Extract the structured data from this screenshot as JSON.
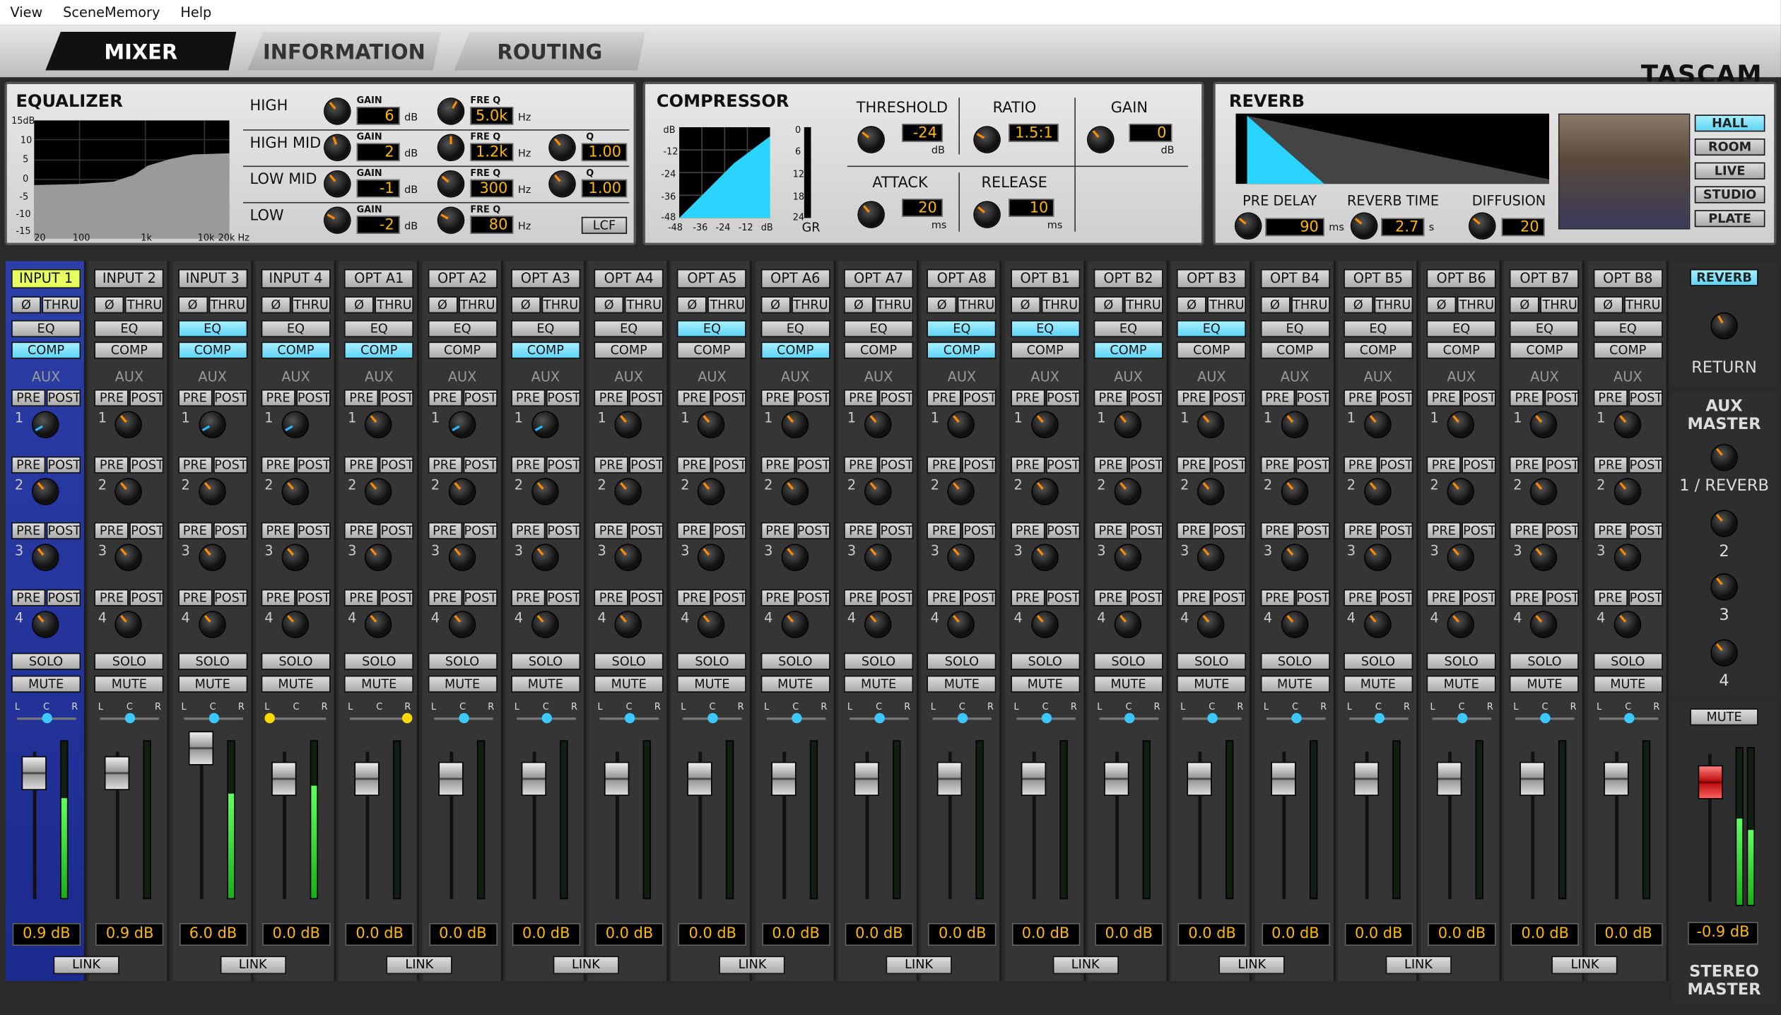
{
  "menu": {
    "view": "View",
    "scene": "SceneMemory",
    "help": "Help"
  },
  "tabs": {
    "mixer": "MIXER",
    "information": "INFORMATION",
    "routing": "ROUTING"
  },
  "brand": "TASCAM",
  "eq": {
    "title": "EQUALIZER",
    "high": "HIGH",
    "high_mid": "HIGH MID",
    "low_mid": "LOW MID",
    "low": "LOW",
    "gain": "GAIN",
    "freq": "FRE Q",
    "q": "Q",
    "db": "dB",
    "hz": "Hz",
    "high_gain": "6",
    "high_freq": "5.0k",
    "hm_gain": "2",
    "hm_freq": "1.2k",
    "hm_q": "1.00",
    "lm_gain": "-1",
    "lm_freq": "300",
    "lm_q": "1.00",
    "low_gain": "-2",
    "low_freq": "80",
    "lcf": "LCF",
    "y15": "15dB",
    "y10": "10",
    "y5": "5",
    "y0": "0",
    "ym5": "-5",
    "ym10": "-10",
    "ym15": "-15",
    "x20": "20",
    "x100": "100",
    "x1k": "1k",
    "x10k": "10k",
    "x20k": "20k Hz"
  },
  "comp": {
    "title": "COMPRESSOR",
    "threshold": "THRESHOLD",
    "threshold_val": "-24",
    "ratio": "RATIO",
    "ratio_val": "1.5:1",
    "gain": "GAIN",
    "gain_val": "0",
    "attack": "ATTACK",
    "attack_val": "20",
    "release": "RELEASE",
    "release_val": "10",
    "db": "dB",
    "ms": "ms",
    "gr": "GR",
    "yd": "dB",
    "y12": "-12",
    "y24": "-24",
    "y36": "-36",
    "y48": "-48",
    "x48": "-48",
    "x36": "-36",
    "x24": "-24",
    "x12": "-12",
    "xd": "dB",
    "g0": "0",
    "g6": "6",
    "g12": "12",
    "g18": "18",
    "g24": "24"
  },
  "reverb": {
    "title": "REVERB",
    "pre_delay": "PRE DELAY",
    "pre_delay_val": "90",
    "reverb_time": "REVERB TIME",
    "reverb_time_val": "2.7",
    "diffusion": "DIFFUSION",
    "diffusion_val": "20",
    "ms": "ms",
    "s": "s",
    "types": [
      "HALL",
      "ROOM",
      "LIVE",
      "STUDIO",
      "PLATE"
    ]
  },
  "strip_labels": {
    "phase": "Ø",
    "thru": "THRU",
    "eq": "EQ",
    "comp": "COMP",
    "aux": "AUX",
    "pre": "PRE",
    "post": "POST",
    "solo": "SOLO",
    "mute": "MUTE",
    "l": "L",
    "c": "C",
    "r": "R",
    "link": "LINK",
    "n1": "1",
    "n2": "2",
    "n3": "3",
    "n4": "4"
  },
  "channels": [
    {
      "name": "INPUT 1",
      "eq": false,
      "comp": true,
      "fader": "0.9 dB",
      "meter": 0.64
    },
    {
      "name": "INPUT 2",
      "eq": false,
      "comp": false,
      "fader": "0.9 dB",
      "meter": 0.0
    },
    {
      "name": "INPUT 3",
      "eq": true,
      "comp": true,
      "fader": "6.0 dB",
      "meter": 0.67
    },
    {
      "name": "INPUT 4",
      "eq": false,
      "comp": true,
      "fader": "0.0 dB",
      "meter": 0.72
    },
    {
      "name": "OPT A1",
      "eq": false,
      "comp": true,
      "fader": "0.0 dB",
      "meter": 0.0
    },
    {
      "name": "OPT A2",
      "eq": false,
      "comp": false,
      "fader": "0.0 dB",
      "meter": 0.0
    },
    {
      "name": "OPT A3",
      "eq": false,
      "comp": true,
      "fader": "0.0 dB",
      "meter": 0.0
    },
    {
      "name": "OPT A4",
      "eq": false,
      "comp": false,
      "fader": "0.0 dB",
      "meter": 0.0
    },
    {
      "name": "OPT A5",
      "eq": true,
      "comp": false,
      "fader": "0.0 dB",
      "meter": 0.0
    },
    {
      "name": "OPT A6",
      "eq": false,
      "comp": true,
      "fader": "0.0 dB",
      "meter": 0.0
    },
    {
      "name": "OPT A7",
      "eq": false,
      "comp": false,
      "fader": "0.0 dB",
      "meter": 0.0
    },
    {
      "name": "OPT A8",
      "eq": true,
      "comp": true,
      "fader": "0.0 dB",
      "meter": 0.0
    },
    {
      "name": "OPT B1",
      "eq": true,
      "comp": false,
      "fader": "0.0 dB",
      "meter": 0.0
    },
    {
      "name": "OPT B2",
      "eq": false,
      "comp": true,
      "fader": "0.0 dB",
      "meter": 0.0
    },
    {
      "name": "OPT B3",
      "eq": true,
      "comp": false,
      "fader": "0.0 dB",
      "meter": 0.0
    },
    {
      "name": "OPT B4",
      "eq": false,
      "comp": false,
      "fader": "0.0 dB",
      "meter": 0.0
    },
    {
      "name": "OPT B5",
      "eq": false,
      "comp": false,
      "fader": "0.0 dB",
      "meter": 0.0
    },
    {
      "name": "OPT B6",
      "eq": false,
      "comp": false,
      "fader": "0.0 dB",
      "meter": 0.0
    },
    {
      "name": "OPT B7",
      "eq": false,
      "comp": false,
      "fader": "0.0 dB",
      "meter": 0.0
    },
    {
      "name": "OPT B8",
      "eq": false,
      "comp": false,
      "fader": "0.0 dB",
      "meter": 0.0
    }
  ],
  "right": {
    "reverb_btn": "REVERB",
    "return": "RETURN",
    "aux_master": "AUX MASTER",
    "aux1": "1 / REVERB",
    "aux2": "2",
    "aux3": "3",
    "aux4": "4",
    "mute": "MUTE",
    "master_val": "-0.9 dB",
    "stereo_master": "STEREO MASTER"
  },
  "colors": {
    "accent": "#5fd4f5",
    "value": "#ffb800",
    "selected_strip": "#2c3fa8"
  }
}
